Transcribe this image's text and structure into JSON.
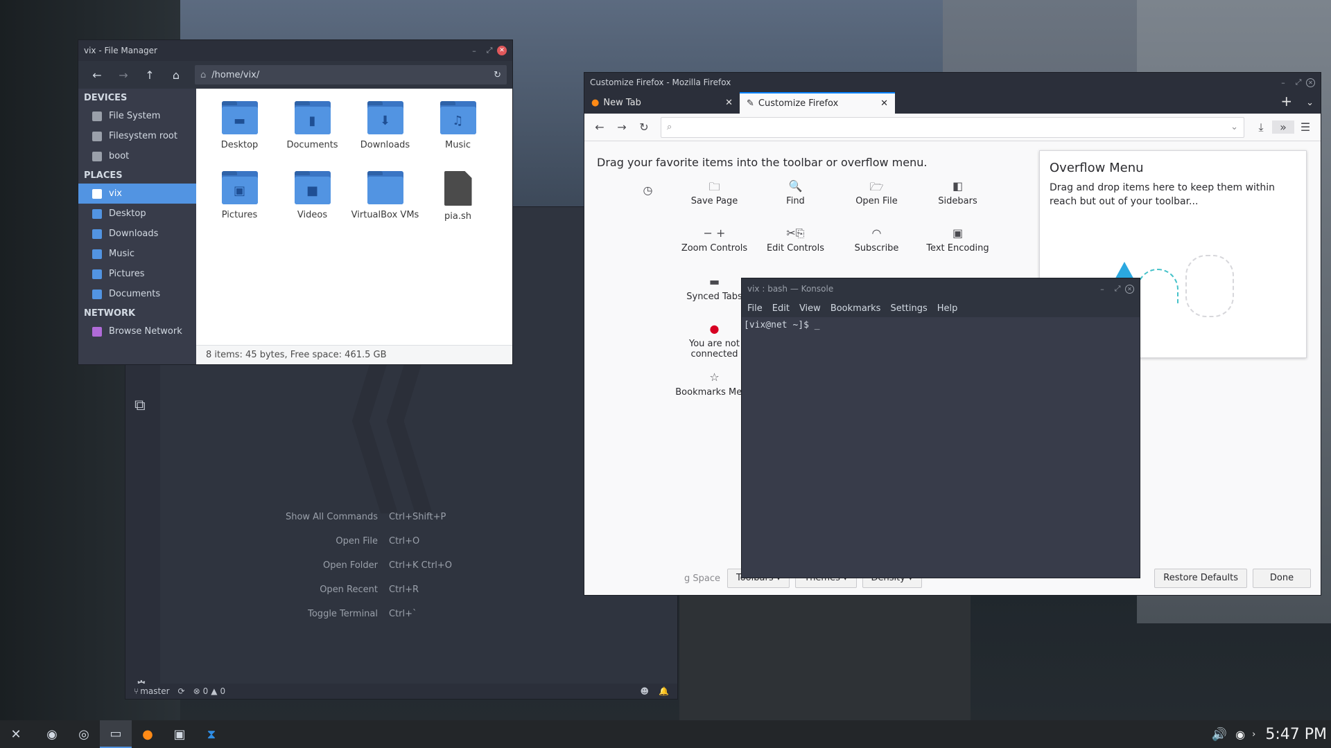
{
  "file_manager": {
    "title": "vix - File Manager",
    "path": "/home/vix/",
    "sections": [
      {
        "header": "DEVICES",
        "items": [
          {
            "label": "File System",
            "color": "#9aa0aa"
          },
          {
            "label": "Filesystem root",
            "color": "#9aa0aa"
          },
          {
            "label": "boot",
            "color": "#9aa0aa"
          }
        ]
      },
      {
        "header": "PLACES",
        "items": [
          {
            "label": "vix",
            "color": "#ffffff",
            "selected": true
          },
          {
            "label": "Desktop",
            "color": "#5294e2"
          },
          {
            "label": "Downloads",
            "color": "#5294e2"
          },
          {
            "label": "Music",
            "color": "#5294e2"
          },
          {
            "label": "Pictures",
            "color": "#5294e2"
          },
          {
            "label": "Documents",
            "color": "#5294e2"
          }
        ]
      },
      {
        "header": "NETWORK",
        "items": [
          {
            "label": "Browse Network",
            "color": "#b06bd8"
          }
        ]
      }
    ],
    "files": [
      {
        "name": "Desktop",
        "icon": "▬"
      },
      {
        "name": "Documents",
        "icon": "▮"
      },
      {
        "name": "Downloads",
        "icon": "⬇"
      },
      {
        "name": "Music",
        "icon": "♫"
      },
      {
        "name": "Pictures",
        "icon": "▣"
      },
      {
        "name": "Videos",
        "icon": "■"
      },
      {
        "name": "VirtualBox VMs",
        "icon": ""
      },
      {
        "name": "pia.sh",
        "icon": "file"
      }
    ],
    "status": "8 items: 45 bytes, Free space: 461.5 GB"
  },
  "firefox": {
    "title": "Customize Firefox - Mozilla Firefox",
    "tabs": [
      {
        "label": "New Tab"
      },
      {
        "label": "Customize Firefox"
      }
    ],
    "drag_text": "Drag your favorite items into the toolbar or overflow menu.",
    "items": [
      {
        "label": "Save Page",
        "icon": "🗀"
      },
      {
        "label": "Find",
        "icon": "🔍"
      },
      {
        "label": "Open File",
        "icon": "🗁"
      },
      {
        "label": "Sidebars",
        "icon": "◧"
      },
      {
        "label": "Zoom Controls",
        "icon": "− +"
      },
      {
        "label": "Edit Controls",
        "icon": "✂⎘"
      },
      {
        "label": "Subscribe",
        "icon": "◠"
      },
      {
        "label": "Text Encoding",
        "icon": "▣"
      },
      {
        "label": "Synced Tabs",
        "icon": "▬"
      },
      {
        "label": "You are not connected",
        "icon": "●"
      },
      {
        "label": "Bookmarks Menu",
        "icon": "☆"
      }
    ],
    "overflow_title": "Overflow Menu",
    "overflow_text": "Drag and drop items here to keep them within reach but out of your toolbar...",
    "bottom": {
      "space": "g Space",
      "toolbars": "Toolbars ▾",
      "themes": "Themes ▾",
      "density": "Density ▾",
      "restore": "Restore Defaults",
      "done": "Done"
    }
  },
  "vscode": {
    "commands": [
      {
        "label": "Show All Commands",
        "key": "Ctrl+Shift+P"
      },
      {
        "label": "Open File",
        "key": "Ctrl+O"
      },
      {
        "label": "Open Folder",
        "key": "Ctrl+K Ctrl+O"
      },
      {
        "label": "Open Recent",
        "key": "Ctrl+R"
      },
      {
        "label": "Toggle Terminal",
        "key": "Ctrl+`"
      }
    ],
    "branch": "master",
    "errors": "0",
    "warnings": "0"
  },
  "konsole": {
    "title": "vix : bash — Konsole",
    "menu": [
      "File",
      "Edit",
      "View",
      "Bookmarks",
      "Settings",
      "Help"
    ],
    "prompt": "[vix@net ~]$ _"
  },
  "taskbar": {
    "clock": "5:47 PM"
  }
}
